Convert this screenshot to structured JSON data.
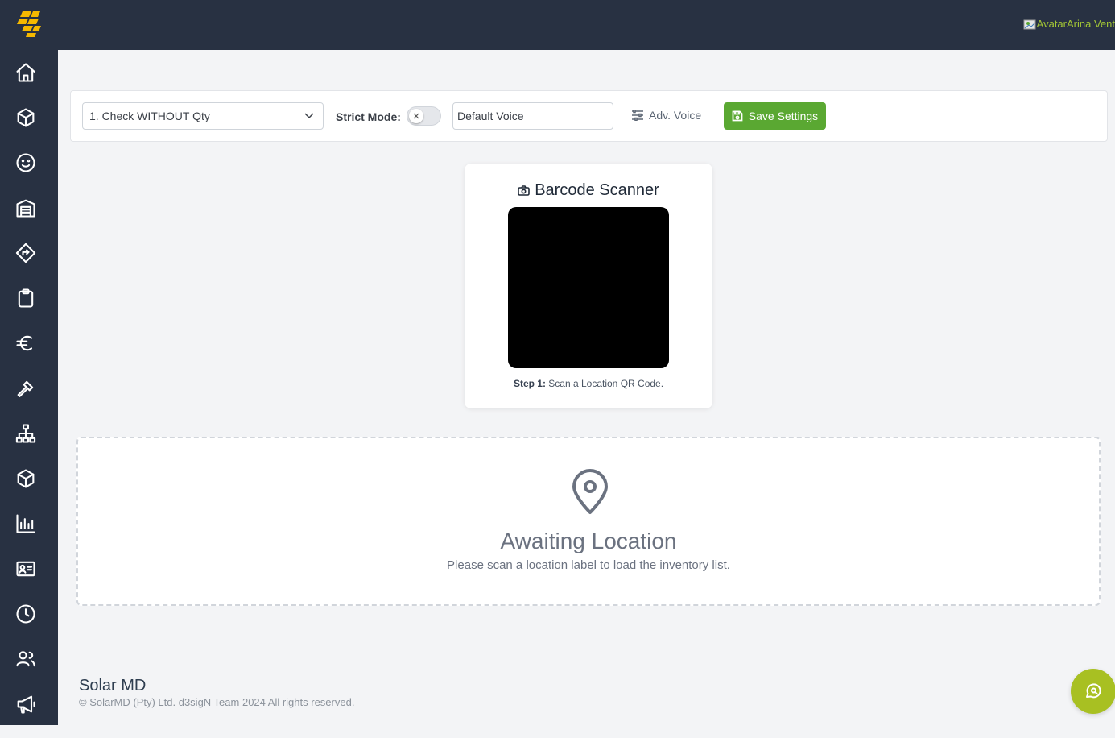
{
  "header": {
    "avatar_alt": "Avatar",
    "user_name": "Arina Vent"
  },
  "sidebar": {
    "items": [
      {
        "icon": "home-icon"
      },
      {
        "icon": "box-icon"
      },
      {
        "icon": "smile-icon"
      },
      {
        "icon": "warehouse-icon"
      },
      {
        "icon": "directions-icon"
      },
      {
        "icon": "clipboard-icon"
      },
      {
        "icon": "euro-icon"
      },
      {
        "icon": "hammer-icon"
      },
      {
        "icon": "hierarchy-icon"
      },
      {
        "icon": "package-icon"
      },
      {
        "icon": "bar-chart-icon"
      },
      {
        "icon": "id-card-icon"
      },
      {
        "icon": "clock-icon"
      },
      {
        "icon": "users-icon"
      },
      {
        "icon": "megaphone-icon"
      }
    ]
  },
  "toolbar": {
    "mode_value": "1. Check WITHOUT Qty",
    "strict_mode_label": "Strict Mode:",
    "strict_mode_on": false,
    "voice_value": "Default Voice",
    "adv_voice_label": "Adv. Voice",
    "save_label": "Save Settings"
  },
  "scanner": {
    "title": "Barcode Scanner",
    "step_label": "Step 1:",
    "step_text": "Scan a Location QR Code."
  },
  "awaiting": {
    "title": "Awaiting Location",
    "subtitle": "Please scan a location label to load the inventory list."
  },
  "footer": {
    "brand": "Solar MD",
    "copyright": "© SolarMD (Pty) Ltd. d3sigN Team 2024 All rights reserved."
  },
  "colors": {
    "sidebar_bg": "#283142",
    "save_button": "#5aa832",
    "chat_button": "#a8c022",
    "user_name": "#a3c635",
    "logo": "#f5b800"
  }
}
